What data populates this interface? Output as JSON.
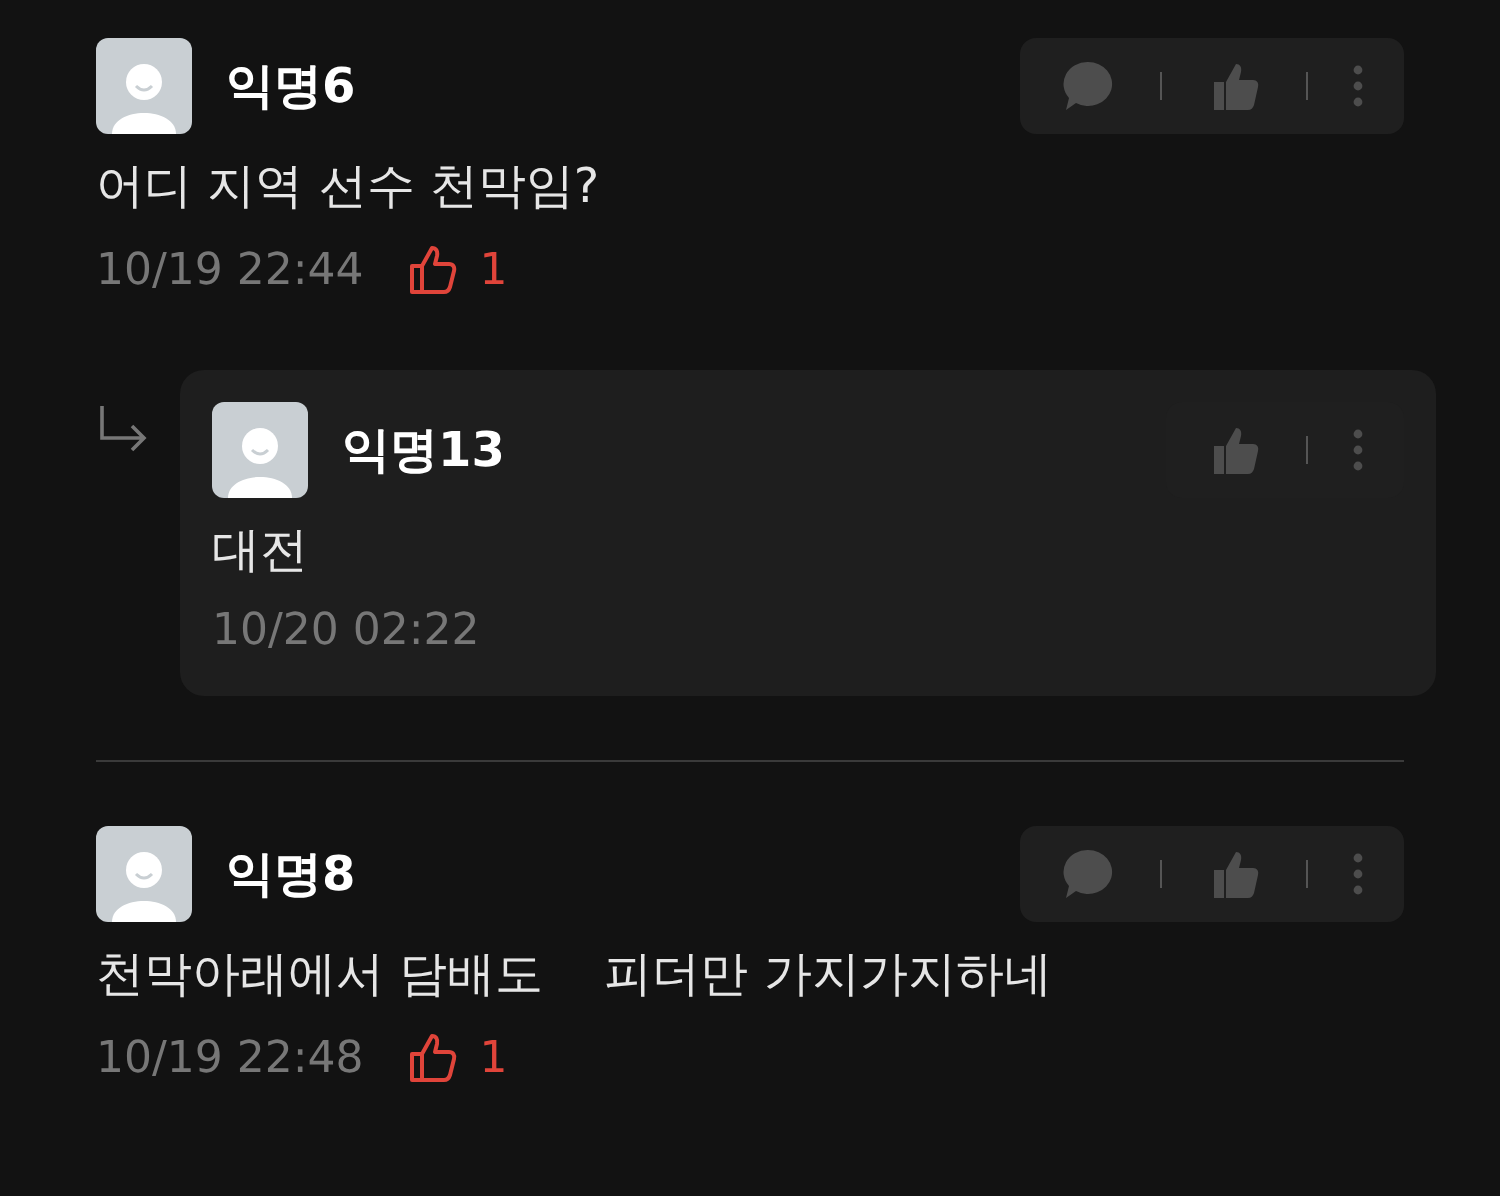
{
  "comments": [
    {
      "kind": "comment",
      "author": "익명6",
      "text": "어디 지역 선수 천막임?",
      "time": "10/19 22:44",
      "likes": "1",
      "actions": [
        {
          "kind": "reply"
        },
        {
          "kind": "like"
        },
        {
          "kind": "more"
        }
      ]
    },
    {
      "kind": "reply",
      "author": "익명13",
      "text": "대전",
      "time": "10/20 02:22",
      "actions": [
        {
          "kind": "like"
        },
        {
          "kind": "more"
        }
      ]
    },
    {
      "kind": "comment",
      "author": "익명8",
      "text": "천막아래에서 담배도    피더만 가지가지하네",
      "time": "10/19 22:48",
      "likes": "1",
      "actions": [
        {
          "kind": "reply"
        },
        {
          "kind": "like"
        },
        {
          "kind": "more"
        }
      ]
    }
  ]
}
